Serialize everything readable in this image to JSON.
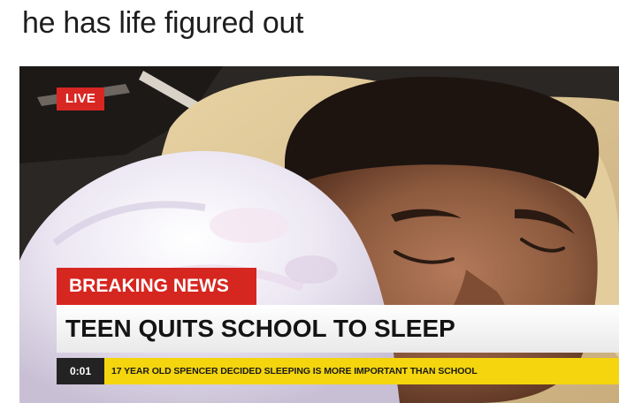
{
  "caption": "he has life figured out",
  "photo": {
    "icon": "sleeping-teen-photo"
  },
  "broadcast": {
    "live_label": "LIVE",
    "breaking_label": "BREAKING NEWS",
    "headline": "TEEN QUITS SCHOOL TO SLEEP",
    "time": "0:01",
    "ticker": "17 YEAR OLD SPENCER DECIDED SLEEPING IS MORE IMPORTANT THAN SCHOOL",
    "colors": {
      "live_red": "#d82722",
      "breaking_red": "#d62620",
      "ticker_yellow": "#f4d50e",
      "time_dark": "#232323"
    }
  }
}
